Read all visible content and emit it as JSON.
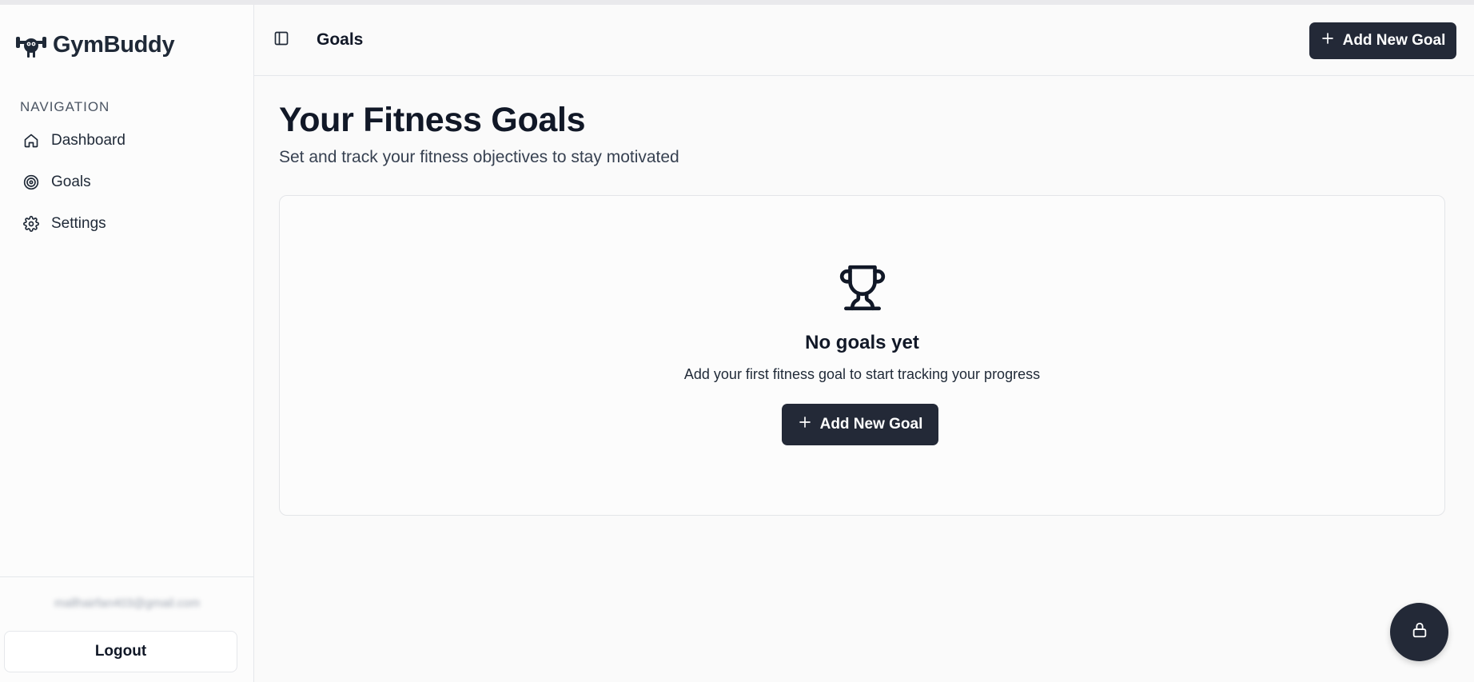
{
  "brand": {
    "name": "GymBuddy",
    "logo_icon": "dumbbell-mascot-icon"
  },
  "sidebar": {
    "heading": "NAVIGATION",
    "items": [
      {
        "label": "Dashboard",
        "icon": "home-icon"
      },
      {
        "label": "Goals",
        "icon": "target-icon"
      },
      {
        "label": "Settings",
        "icon": "gear-icon"
      }
    ],
    "user_email": "mallhairfan403@gmail.com",
    "logout_label": "Logout"
  },
  "header": {
    "title": "Goals",
    "toggle_icon": "sidebar-toggle-icon",
    "add_goal_label": "Add New Goal"
  },
  "main": {
    "title": "Your Fitness Goals",
    "subtitle": "Set and track your fitness objectives to stay motivated",
    "empty_state": {
      "icon": "trophy-icon",
      "title": "No goals yet",
      "description": "Add your first fitness goal to start tracking your progress",
      "button_label": "Add New Goal"
    }
  },
  "fab": {
    "icon": "lock-icon"
  },
  "colors": {
    "primary_button": "#232937",
    "background": "#fafafa",
    "border": "#e5e7eb",
    "text": "#111827"
  }
}
